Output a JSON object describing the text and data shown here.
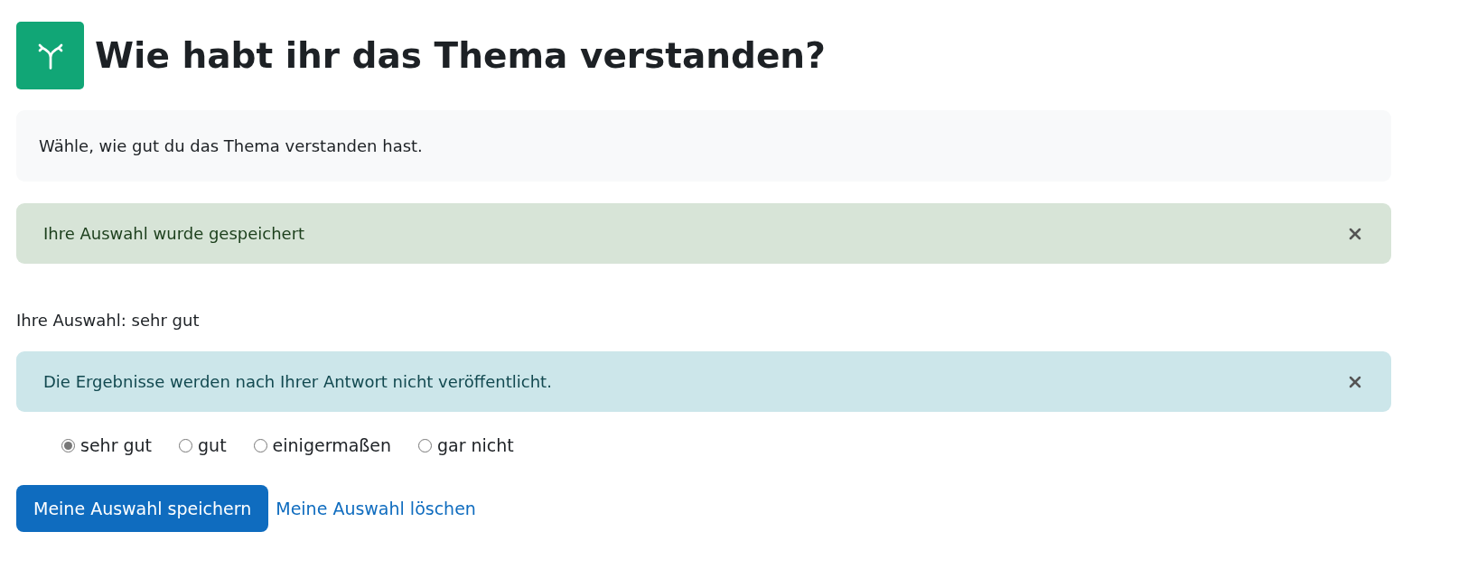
{
  "title": "Wie habt ihr das Thema verstanden?",
  "description": "Wähle, wie gut du das Thema verstanden hast.",
  "alerts_top": [
    {
      "kind": "success",
      "text": "Ihre Auswahl wurde gespeichert"
    }
  ],
  "current_choice": "Ihre Auswahl: sehr gut",
  "alerts_bottom": [
    {
      "kind": "info",
      "text": "Die Ergebnisse werden nach Ihrer Antwort nicht veröffentlicht."
    }
  ],
  "options": [
    {
      "label": "sehr gut",
      "selected": true
    },
    {
      "label": "gut",
      "selected": false
    },
    {
      "label": "einigermaßen",
      "selected": false
    },
    {
      "label": "gar nicht",
      "selected": false
    }
  ],
  "save_button": "Meine Auswahl speichern",
  "clear_link": "Meine Auswahl löschen"
}
